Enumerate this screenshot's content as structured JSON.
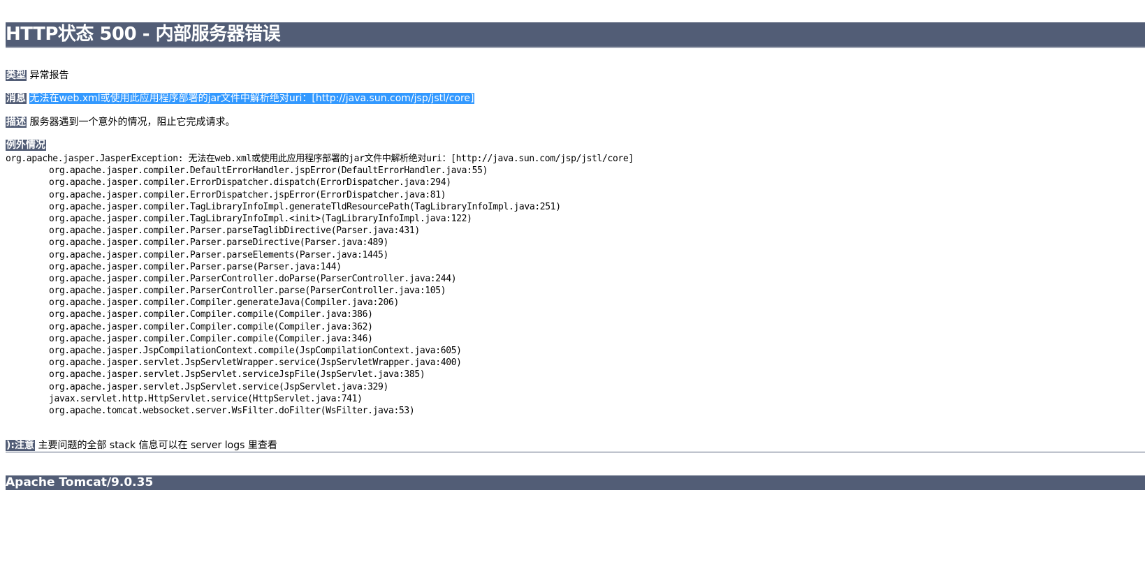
{
  "title": "HTTP状态 500 - 内部服务器错误",
  "type": {
    "label": "类型",
    "value": "异常报告"
  },
  "message": {
    "label": "消息",
    "value": "无法在web.xml或使用此应用程序部署的jar文件中解析绝对uri：[http://java.sun.com/jsp/jstl/core]"
  },
  "description": {
    "label": "描述",
    "value": "服务器遇到一个意外的情况，阻止它完成请求。"
  },
  "exception": {
    "label": "例外情况",
    "header": "org.apache.jasper.JasperException: 无法在web.xml或使用此应用程序部署的jar文件中解析绝对uri：[http://java.sun.com/jsp/jstl/core]",
    "frames": [
      "org.apache.jasper.compiler.DefaultErrorHandler.jspError(DefaultErrorHandler.java:55)",
      "org.apache.jasper.compiler.ErrorDispatcher.dispatch(ErrorDispatcher.java:294)",
      "org.apache.jasper.compiler.ErrorDispatcher.jspError(ErrorDispatcher.java:81)",
      "org.apache.jasper.compiler.TagLibraryInfoImpl.generateTldResourcePath(TagLibraryInfoImpl.java:251)",
      "org.apache.jasper.compiler.TagLibraryInfoImpl.<init>(TagLibraryInfoImpl.java:122)",
      "org.apache.jasper.compiler.Parser.parseTaglibDirective(Parser.java:431)",
      "org.apache.jasper.compiler.Parser.parseDirective(Parser.java:489)",
      "org.apache.jasper.compiler.Parser.parseElements(Parser.java:1445)",
      "org.apache.jasper.compiler.Parser.parse(Parser.java:144)",
      "org.apache.jasper.compiler.ParserController.doParse(ParserController.java:244)",
      "org.apache.jasper.compiler.ParserController.parse(ParserController.java:105)",
      "org.apache.jasper.compiler.Compiler.generateJava(Compiler.java:206)",
      "org.apache.jasper.compiler.Compiler.compile(Compiler.java:386)",
      "org.apache.jasper.compiler.Compiler.compile(Compiler.java:362)",
      "org.apache.jasper.compiler.Compiler.compile(Compiler.java:346)",
      "org.apache.jasper.JspCompilationContext.compile(JspCompilationContext.java:605)",
      "org.apache.jasper.servlet.JspServletWrapper.service(JspServletWrapper.java:400)",
      "org.apache.jasper.servlet.JspServlet.serviceJspFile(JspServlet.java:385)",
      "org.apache.jasper.servlet.JspServlet.service(JspServlet.java:329)",
      "javax.servlet.http.HttpServlet.service(HttpServlet.java:741)",
      "org.apache.tomcat.websocket.server.WsFilter.doFilter(WsFilter.java:53)"
    ]
  },
  "note": {
    "label": "):注意",
    "value": "主要问题的全部 stack 信息可以在 server logs 里查看"
  },
  "footer": "Apache Tomcat/9.0.35",
  "colors": {
    "header_bg": "#525d76",
    "header_text": "#ffffff",
    "selection": "#3399ff"
  }
}
